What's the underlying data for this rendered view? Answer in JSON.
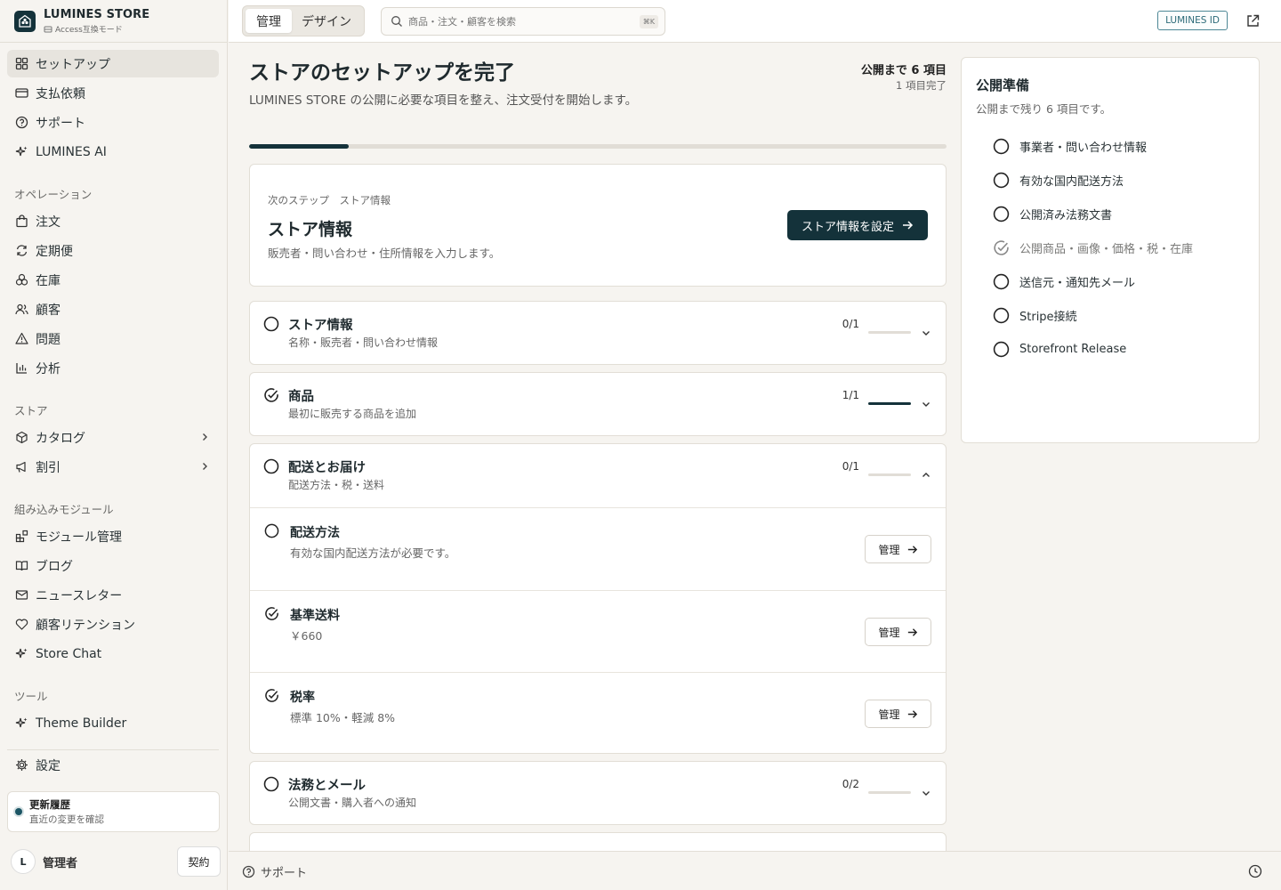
{
  "brand": {
    "title": "LUMINES STORE",
    "subtitle": "Access互換モード"
  },
  "sidebar": {
    "primary": [
      {
        "label": "セットアップ",
        "icon": "dashboard-icon"
      },
      {
        "label": "支払依頼",
        "icon": "card-icon"
      },
      {
        "label": "サポート",
        "icon": "help-icon"
      },
      {
        "label": "LUMINES AI",
        "icon": "sparkle-icon"
      }
    ],
    "section_operations": "オペレーション",
    "operations": [
      {
        "label": "注文",
        "icon": "bag-icon"
      },
      {
        "label": "定期便",
        "icon": "refresh-icon"
      },
      {
        "label": "在庫",
        "icon": "boxes-icon"
      },
      {
        "label": "顧客",
        "icon": "users-icon"
      },
      {
        "label": "問題",
        "icon": "warning-icon"
      },
      {
        "label": "分析",
        "icon": "chart-icon"
      }
    ],
    "section_store": "ストア",
    "store": [
      {
        "label": "カタログ",
        "icon": "package-icon"
      },
      {
        "label": "割引",
        "icon": "megaphone-icon"
      }
    ],
    "section_modules": "組み込みモジュール",
    "modules": [
      {
        "label": "モジュール管理",
        "icon": "blocks-icon"
      },
      {
        "label": "ブログ",
        "icon": "book-icon"
      },
      {
        "label": "ニュースレター",
        "icon": "mail-icon"
      },
      {
        "label": "顧客リテンション",
        "icon": "heart-icon"
      },
      {
        "label": "Store Chat",
        "icon": "sparkle-icon"
      }
    ],
    "section_tools": "ツール",
    "tools": [
      {
        "label": "Theme Builder",
        "icon": "sparkle-icon"
      }
    ],
    "settings": {
      "label": "設定",
      "icon": "gear-icon"
    },
    "update": {
      "title": "更新履歴",
      "subtitle": "直近の変更を確認"
    },
    "user": {
      "initial": "L",
      "name": "管理者",
      "contract": "契約"
    }
  },
  "topbar": {
    "mode_manage": "管理",
    "mode_design": "デザイン",
    "search_placeholder": "商品・注文・顧客を検索",
    "search_shortcut": "⌘K",
    "id_badge": "LUMINES ID"
  },
  "main": {
    "title": "ストアのセットアップを完了",
    "subtitle": "LUMINES STORE の公開に必要な項目を整え、注文受付を開始します。",
    "remaining": "公開まで 6 項目",
    "completed": "1 項目完了",
    "progress": 0.143,
    "next": {
      "eyebrow": "次のステップ　ストア情報",
      "title": "ストア情報",
      "description": "販売者・問い合わせ・住所情報を入力します。",
      "button": "ストア情報を設定"
    },
    "sections": [
      {
        "title": "ストア情報",
        "subtitle": "名称・販売者・問い合わせ情報",
        "count": "0/1",
        "progress": 0,
        "done": false,
        "expanded": false
      },
      {
        "title": "商品",
        "subtitle": "最初に販売する商品を追加",
        "count": "1/1",
        "progress": 1,
        "done": true,
        "expanded": false
      },
      {
        "title": "配送とお届け",
        "subtitle": "配送方法・税・送料",
        "count": "0/1",
        "progress": 0,
        "done": false,
        "expanded": true,
        "items": [
          {
            "title": "配送方法",
            "description": "有効な国内配送方法が必要です。",
            "done": false,
            "button": "管理"
          },
          {
            "title": "基準送料",
            "description": "￥660",
            "done": true,
            "button": "管理"
          },
          {
            "title": "税率",
            "description": "標準 10%・軽減 8%",
            "done": true,
            "button": "管理"
          }
        ]
      },
      {
        "title": "法務とメール",
        "subtitle": "公開文書・購入者への通知",
        "count": "0/2",
        "progress": 0,
        "done": false,
        "expanded": false
      }
    ]
  },
  "checklist": {
    "title": "公開準備",
    "subtitle": "公開まで残り 6 項目です。",
    "items": [
      {
        "label": "事業者・問い合わせ情報",
        "done": false
      },
      {
        "label": "有効な国内配送方法",
        "done": false
      },
      {
        "label": "公開済み法務文書",
        "done": false
      },
      {
        "label": "公開商品・画像・価格・税・在庫",
        "done": true
      },
      {
        "label": "送信元・通知先メール",
        "done": false
      },
      {
        "label": "Stripe接続",
        "done": false
      },
      {
        "label": "Storefront Release",
        "done": false
      }
    ]
  },
  "footer": {
    "support": "サポート"
  },
  "colors": {
    "primary": "#14323a",
    "accent": "#2c6a78",
    "background": "#f6f4f0",
    "border": "#e2ded6"
  }
}
